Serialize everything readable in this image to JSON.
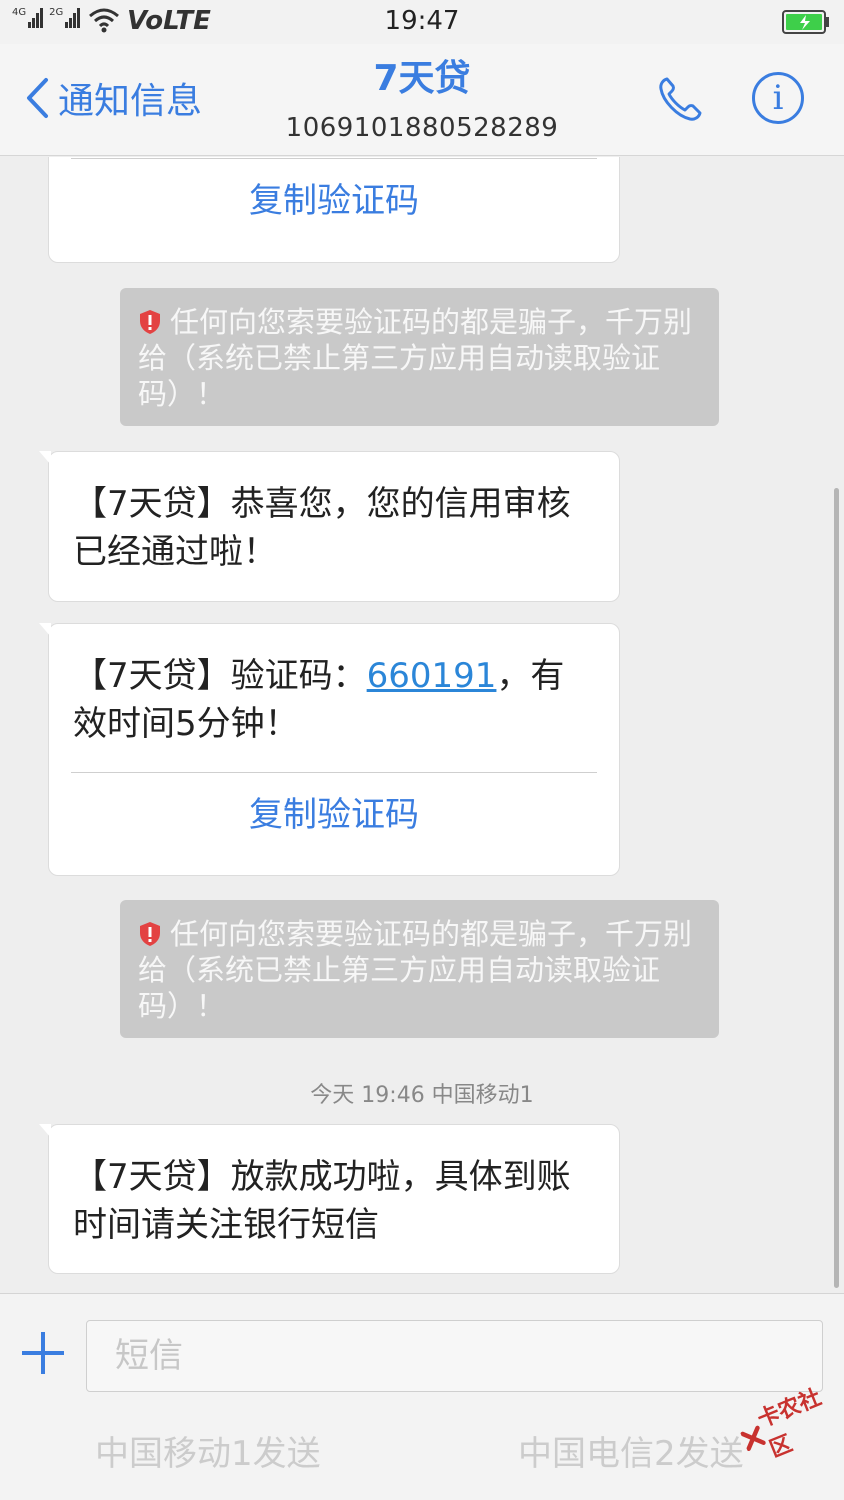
{
  "status_bar": {
    "network_1": "4G",
    "network_2": "2G",
    "carrier_tech": "VoLTE",
    "time": "19:47",
    "battery_color": "#3ecf4a"
  },
  "header": {
    "back_label": "通知信息",
    "title": "7天贷",
    "subtitle": "1069101880528289",
    "call_icon": "phone-icon",
    "info_label": "i"
  },
  "messages": {
    "copy_label": "复制验证码",
    "warning_text": "任何向您索要验证码的都是骗子，千万别给（系统已禁止第三方应用自动读取验证码）！",
    "msg_approved": "【7天贷】恭喜您，您的信用审核已经通过啦！",
    "msg_code_prefix": "【7天贷】验证码：",
    "msg_code": "660191",
    "msg_code_suffix": "，有效时间5分钟！",
    "timestamp": "今天 19:46 中国移动1",
    "msg_loan": "【7天贷】放款成功啦，具体到账时间请关注银行短信"
  },
  "input": {
    "placeholder": "短信",
    "send_sim1": "中国移动1发送",
    "send_sim2": "中国电信2发送"
  },
  "watermark": {
    "text": "卡农社区"
  },
  "colors": {
    "accent": "#3a7de0",
    "link": "#2b86d8",
    "warning_bg": "#c9c9c9",
    "shield": "#e34242"
  }
}
